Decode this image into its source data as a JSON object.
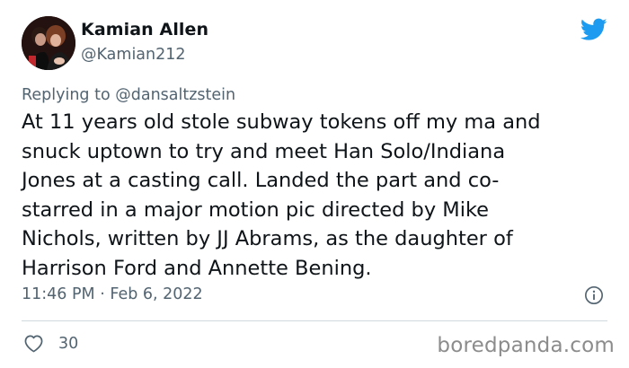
{
  "author": {
    "display_name": "Kamian Allen",
    "handle": "@Kamian212",
    "avatar_icon": "user-avatar"
  },
  "platform_icon": "twitter-bird-icon",
  "brand_color": "#1d9bf0",
  "reply": {
    "prefix": "Replying to ",
    "mention": "@dansaltzstein"
  },
  "tweet": {
    "text": "At 11 years old stole subway tokens off my ma and\nsnuck uptown to try and meet Han Solo/Indiana\nJones at a casting call. Landed the part and co-\nstarred in a major motion pic directed by Mike\nNichols, written by JJ Abrams, as the daughter of\nHarrison Ford and Annette Bening.",
    "timestamp": "11:46 PM · Feb 6, 2022"
  },
  "actions": {
    "like_icon": "heart-icon",
    "like_count": "30",
    "info_icon": "info-icon"
  },
  "watermark": "boredpanda.com"
}
